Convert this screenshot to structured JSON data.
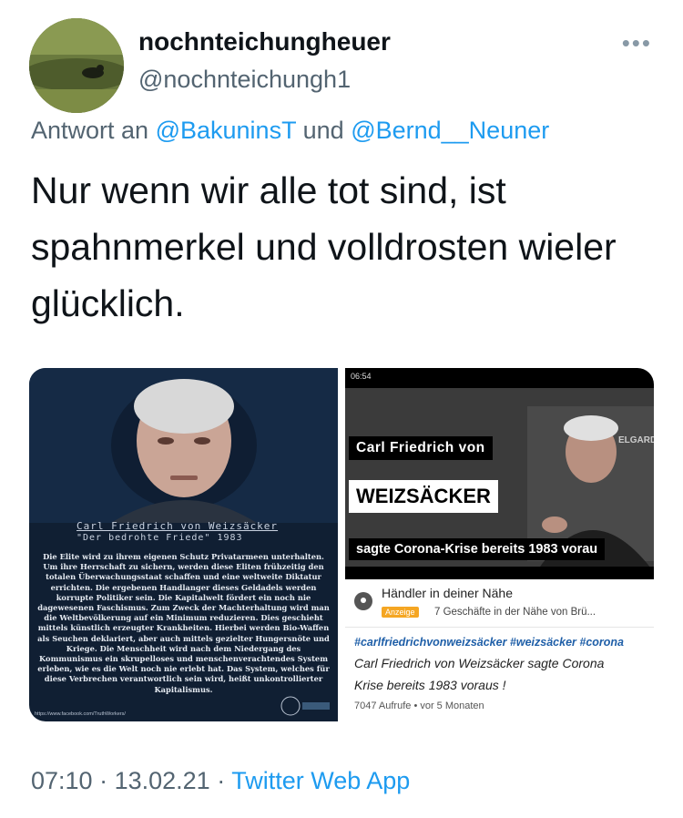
{
  "author": {
    "display_name": "nochnteichungheuer",
    "handle": "@nochnteichungh1"
  },
  "reply_to": {
    "prefix": "Antwort an",
    "mention1": "@BakuninsT",
    "conjunction": "und",
    "mention2": "@Bernd__Neuner"
  },
  "tweet": {
    "line1": "Nur wenn wir alle tot sind, ist",
    "line2": "spahnmerkel und volldrosten wieler",
    "line3": "glücklich."
  },
  "media_left": {
    "caption_line1": "Carl Friedrich von Weizsäcker",
    "caption_line2": "\"Der bedrohte Friede\" 1983",
    "body": "Die Elite wird zu ihrem eigenen Schutz Privatarmeen unterhalten. Um ihre Herrschaft zu sichern, werden diese Eliten frühzeitig den totalen Überwachungsstaat schaffen und eine weltweite Diktatur errichten. Die ergebenen Handlanger dieses Geldadels werden korrupte Politiker sein. Die Kapitalwelt fördert ein noch nie dagewesenen Faschismus. Zum Zweck der Machterhaltung wird man die Weltbevölkerung auf ein Minimum reduzieren. Dies geschieht mittels künstlich erzeugter Krankheiten. Hierbei werden Bio-Waffen als Seuchen deklariert, aber auch mittels gezielter Hungersnöte und Kriege. Die Menschheit wird nach dem Niedergang des Kommunismus ein skrupelloses und menschenverachtendes System erleben, wie es die Welt noch nie erlebt hat. Das System, welches für diese Verbrechen verantwortlich sein wird, heißt unkontrollierter Kapitalismus.",
    "url": "https://www.facebook.com/TruthWorkers/"
  },
  "media_right": {
    "status_time": "06:54",
    "overlay_line1": "Carl Friedrich von",
    "overlay_line2": "WEIZSÄCKER",
    "overlay_line3": "sagte Corona-Krise bereits 1983 vorau",
    "channel_logo": "ELGARD",
    "ad_title": "Händler in deiner Nähe",
    "ad_badge": "Anzeige",
    "ad_subtitle": "7 Geschäfte in der Nähe von Brü...",
    "hashtags": "#carlfriedrichvonweizsäcker #weizsäcker #corona",
    "video_title_line1": "Carl Friedrich von Weizsäcker sagte Corona",
    "video_title_line2": "Krise bereits 1983 voraus !",
    "video_meta": "7047 Aufrufe • vor 5 Monaten"
  },
  "footer": {
    "time": "07:10",
    "sep1": " · ",
    "date": "13.02.21",
    "sep2": " · ",
    "app": "Twitter Web App"
  },
  "colors": {
    "link": "#1d9bf0",
    "secondary_text": "#536471",
    "hashtag": "#1f5fa8",
    "ad_badge": "#f5a623"
  },
  "icons": [
    "more-icon",
    "location-pin-icon"
  ]
}
